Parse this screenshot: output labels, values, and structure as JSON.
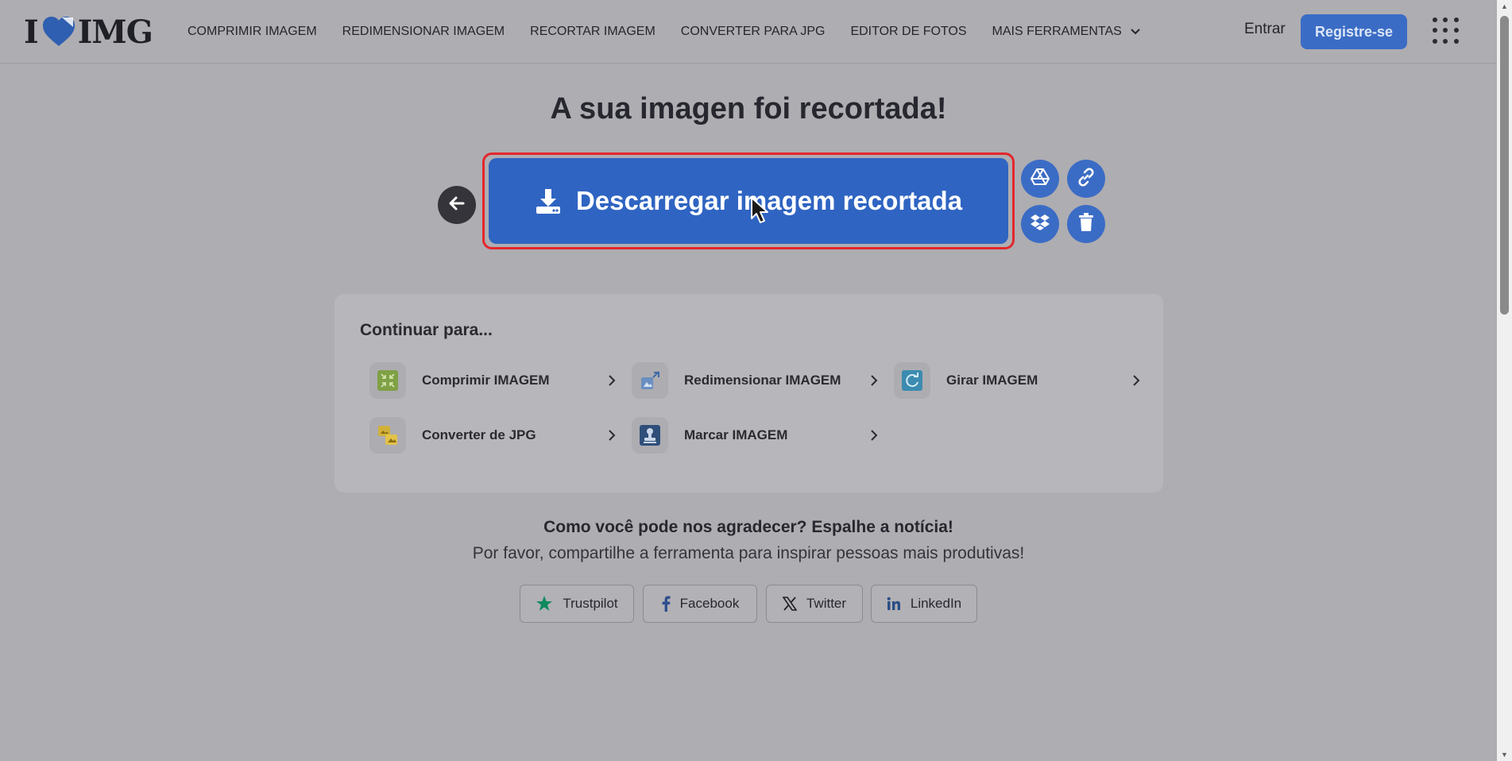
{
  "header": {
    "logo_left": "I",
    "logo_right": "IMG",
    "nav": [
      {
        "label": "COMPRIMIR IMAGEM"
      },
      {
        "label": "REDIMENSIONAR IMAGEM"
      },
      {
        "label": "RECORTAR IMAGEM"
      },
      {
        "label": "CONVERTER PARA JPG"
      },
      {
        "label": "EDITOR DE FOTOS"
      },
      {
        "label": "MAIS FERRAMENTAS"
      }
    ],
    "login_label": "Entrar",
    "register_label": "Registre-se"
  },
  "main": {
    "title": "A sua imagen foi recortada!",
    "download_label": "Descarregar imagem recortada",
    "accent_color": "#2f64c2",
    "highlight_color": "#e3262c"
  },
  "continue": {
    "title": "Continuar para...",
    "tools": [
      {
        "label": "Comprimir IMAGEM",
        "icon": "compress-icon"
      },
      {
        "label": "Redimensionar IMAGEM",
        "icon": "resize-icon"
      },
      {
        "label": "Girar IMAGEM",
        "icon": "rotate-icon"
      },
      {
        "label": "Converter de JPG",
        "icon": "convert-icon"
      },
      {
        "label": "Marcar IMAGEM",
        "icon": "stamp-icon"
      }
    ]
  },
  "share": {
    "title": "Como você pode nos agradecer? Espalhe a notícia!",
    "subtitle": "Por favor, compartilhe a ferramenta para inspirar pessoas mais produtivas!",
    "buttons": [
      {
        "label": "Trustpilot",
        "icon": "star-icon"
      },
      {
        "label": "Facebook",
        "icon": "facebook-icon"
      },
      {
        "label": "Twitter",
        "icon": "x-icon"
      },
      {
        "label": "LinkedIn",
        "icon": "linkedin-icon"
      }
    ]
  }
}
